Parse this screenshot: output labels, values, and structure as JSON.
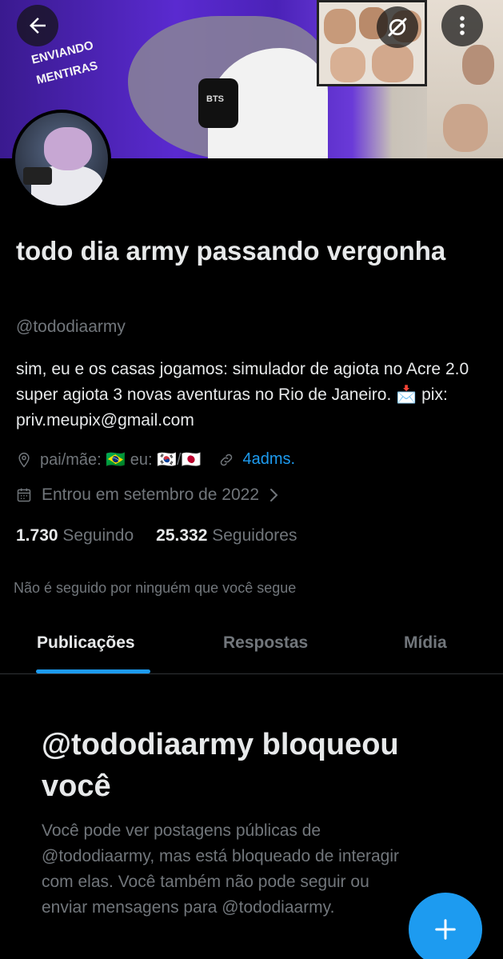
{
  "banner": {
    "sign_text": "ENVIANDO MENTIRAS",
    "badge_text": "BTS"
  },
  "header": {
    "back_icon": "arrow-left-icon",
    "grok_icon": "grok-icon",
    "more_icon": "more-vertical-icon"
  },
  "profile": {
    "display_name": "todo dia army passando vergonha",
    "handle": "@tododiaarmy",
    "bio": "sim, eu e os casas jogamos: simulador de agiota no Acre 2.0 super agiota 3 novas aventuras no Rio de Janeiro. 📩 pix: priv.meupix@gmail.com",
    "location": "pai/mãe: 🇧🇷 eu: 🇰🇷/🇯🇵",
    "website": "4adms.",
    "joined": "Entrou em setembro de 2022",
    "following_count": "1.730",
    "following_label": "Seguindo",
    "followers_count": "25.332",
    "followers_label": "Seguidores",
    "followed_by": "Não é seguido por ninguém que você segue"
  },
  "tabs": [
    {
      "label": "Publicações",
      "active": true
    },
    {
      "label": "Respostas",
      "active": false
    },
    {
      "label": "Mídia",
      "active": false
    }
  ],
  "blocked": {
    "title": "@tododiaarmy bloqueou você",
    "text": "Você pode ver postagens públicas de @tododiaarmy, mas está bloqueado de interagir com elas. Você também não pode seguir ou enviar mensagens para @tododiaarmy."
  },
  "fab": {
    "icon": "plus-icon"
  },
  "colors": {
    "accent": "#1d9bf0",
    "background": "#000000",
    "text_primary": "#e7e9ea",
    "text_secondary": "#71767b"
  }
}
